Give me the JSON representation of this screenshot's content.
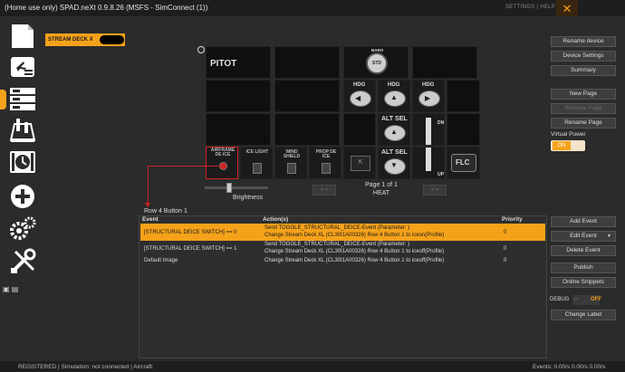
{
  "app": {
    "title": "(Home use only) SPAD.neXt 0.9.8.26 (MSFS - SimConnect (1))",
    "settings_help": "SETTINGS | HELP"
  },
  "device_tab": {
    "label": "STREAM DECK X"
  },
  "deck": {
    "keys": {
      "pitot": "PITOT",
      "baro": "BARO",
      "std": "STD",
      "hdg1": "HDG",
      "hdg2": "HDG",
      "hdg3": "HDG",
      "alt_sel1": "ALT SEL",
      "alt_sel2": "ALT SEL",
      "dn": "DN",
      "up": "UP",
      "airframe_deice": "AIRFRAME DE ICE",
      "ice_light": "ICE LIGHT",
      "wind_shield": "WIND SHIELD",
      "prop_deice": "PROP DE ICE",
      "flc": "FLC"
    },
    "brightness_label": "Brightness",
    "page_label": "Page 1 of 1",
    "page_name": "HEAT"
  },
  "events": {
    "row_label": "Row 4 Button 1",
    "headers": {
      "event": "Event",
      "actions": "Action(s)",
      "priority": "Priority"
    },
    "rows": [
      {
        "event": "[STRUCTURAL DEICE SWITCH] == 0",
        "action_line1": "Send TOGGLE_STRUCTURAL_DEICE-Event (Parameter: )",
        "action_line2": "Change Stream Deck XL (CL30I1A00326) Row 4 Button 1 to iceon(Profile)",
        "priority": "0"
      },
      {
        "event": "[STRUCTURAL DEICE SWITCH] == 1",
        "action_line1": "Send TOGGLE_STRUCTURAL_DEICE-Event (Parameter: )",
        "action_line2": "Change Stream Deck XL (CL30I1A00326) Row 4 Button 1 to iceoff(Profile)",
        "priority": "0"
      },
      {
        "event": "Default Image",
        "action_line1": "Change Stream Deck XL (CL30I1A00326) Row 4 Button 1 to iceoff(Profile)",
        "action_line2": "",
        "priority": "0"
      }
    ]
  },
  "right_panel": {
    "rename_device": "Rename device",
    "device_settings": "Device Settings",
    "summary": "Summary",
    "new_page": "New Page",
    "remove_page": "Remove Page",
    "rename_page": "Rename Page",
    "virtual_power_label": "Virtual Power",
    "virtual_power_on": "ON",
    "add_event": "Add Event",
    "edit_event": "Edit Event",
    "delete_event": "Delete Event",
    "publish": "Publish",
    "online_snippets": "Online Snippets",
    "debug_label": "DEBUG",
    "debug_value": "OFF",
    "change_label": "Change Label"
  },
  "status": {
    "left": "REGISTERED   | Simulation: not connected   | Aircraft:",
    "right": "Events: 0.00/s 0.00/s 0.00/s"
  },
  "colors": {
    "accent": "#f5a21b",
    "background": "#2b2b2b",
    "connector": "#d32020"
  }
}
